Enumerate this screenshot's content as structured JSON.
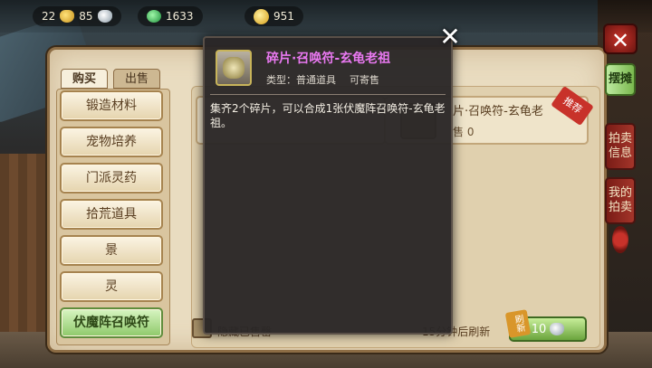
{
  "resources": {
    "gold": "22",
    "silver": "85",
    "jade": "1633",
    "coins": "951"
  },
  "tabs": {
    "buy": "购买",
    "sell": "出售"
  },
  "categories": [
    "锻造材料",
    "宠物培养",
    "门派灵药",
    "拾荒道具",
    "景",
    "灵",
    "伏魔阵召唤符"
  ],
  "active_category": "伏魔阵召唤符",
  "side_tabs": {
    "stall": "摆摊",
    "auction_info": "拍卖信息",
    "my_auction": "我的拍卖"
  },
  "listing": {
    "name": "片·召唤符-玄龟老",
    "stock": "售 0",
    "badge": "推荐"
  },
  "popup": {
    "title": "碎片·召唤符-玄龟老祖",
    "type": "类型：普通道具",
    "tradable": "可寄售",
    "description": "集齐2个碎片，可以合成1张伏魔阵召唤符-玄龟老祖。"
  },
  "bottom": {
    "left_text": "隐藏已售罄",
    "refresh_text": "15分钟后刷新",
    "refresh_tag": "刷新",
    "refresh_cost": "10"
  },
  "colors": {
    "popup_title": "#e878f0",
    "active_green": "#8ec96a",
    "side_red": "#a3352a"
  }
}
